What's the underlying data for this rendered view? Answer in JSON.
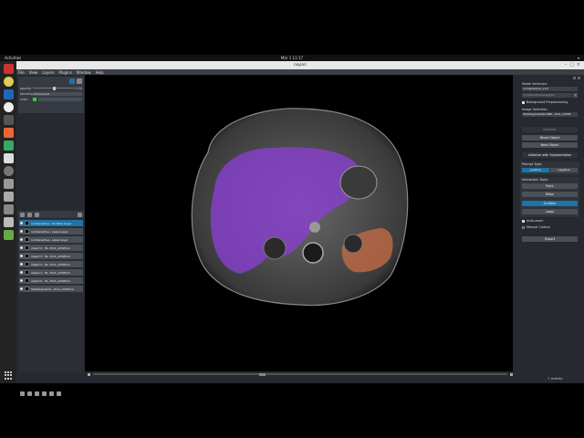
{
  "topbar": {
    "activities": "Activities",
    "app": "napari",
    "clock": "Mär 1  11:17"
  },
  "window": {
    "title": "napari"
  },
  "menu": [
    "File",
    "View",
    "Layers",
    "Plugins",
    "Window",
    "Help"
  ],
  "layer_controls": {
    "opacity_label": "opacity:",
    "opacity_value": 0.5,
    "opacity_text": "0.50",
    "blending_label": "blending:",
    "blending_value": "translucent",
    "color_label": "color:"
  },
  "layers": [
    {
      "name": "nnInteractive - Scribble Layer",
      "active": true
    },
    {
      "name": "nnInteractive - Lasso Layer",
      "active": false
    },
    {
      "name": "nnInteractive - Label Layer",
      "active": false
    },
    {
      "name": "object 4 - Te...Pro1_oll328.nii",
      "active": false
    },
    {
      "name": "object 3 - Te...Pro1_oll328.nii",
      "active": false
    },
    {
      "name": "object 2 - Te...Pro1_oll328.nii",
      "active": false
    },
    {
      "name": "object 1 - Te...Pro1_oll328.nii",
      "active": false
    },
    {
      "name": "object 0 - Te...Pro1_oll328.nii",
      "active": false
    },
    {
      "name": "TotalSegmenta...Pro1_oll328.nii",
      "active": false
    }
  ],
  "right_panel": {
    "model_selection_label": "Model Selection:",
    "model_value": "nnInteractive_v1.0",
    "model_path": "/nnInteractive/weights/",
    "background_preprocessing": "Background Preprocessing",
    "image_selection_label": "Image Selection:",
    "image_value": "TotalSegmentatorMRI...Pro1_oll328",
    "initialize": "Initialize",
    "reset_object": "Reset Object",
    "next_object": "Next Object",
    "init_with_segmentation": "Initialize with Segmentation",
    "prompt_type_label": "Prompt Type:",
    "prompt_positive": "positive",
    "prompt_negative": "negative",
    "interaction_tools_label": "Interaction Tools:",
    "tool_point": "Point",
    "tool_bbox": "BBox",
    "tool_scribble": "Scribble",
    "tool_lasso": "Lasso",
    "auto_zoom": "Auto-zoom",
    "manual_control": "Manual Control",
    "export": "Export"
  },
  "status": {
    "activity": "↑ activity"
  },
  "colors": {
    "liver_overlay": "#8a3fd1",
    "stomach_overlay": "#c06a45",
    "active_blue": "#1e73a8",
    "panel_bg": "#262930",
    "color_swatch": "#33cc33"
  }
}
